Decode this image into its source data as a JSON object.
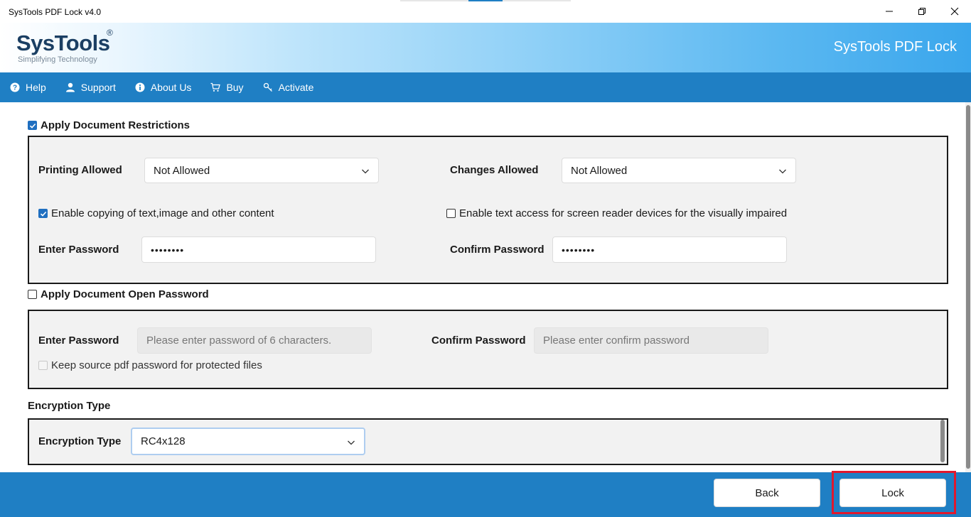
{
  "window": {
    "title": "SysTools PDF Lock v4.0",
    "minimize_icon": "minimize-icon",
    "maximize_icon": "restore-icon",
    "close_icon": "close-icon"
  },
  "header": {
    "logo_text": "SysTools",
    "logo_registered": "®",
    "logo_tagline": "Simplifying Technology",
    "app_name": "SysTools PDF Lock"
  },
  "menu": {
    "items": [
      {
        "label": "Help",
        "icon": "question-circle-icon"
      },
      {
        "label": "Support",
        "icon": "user-icon"
      },
      {
        "label": "About Us",
        "icon": "info-circle-icon"
      },
      {
        "label": "Buy",
        "icon": "cart-icon"
      },
      {
        "label": "Activate",
        "icon": "key-icon"
      }
    ]
  },
  "restrictions": {
    "checkbox_label": "Apply Document Restrictions",
    "checked": true,
    "printing_label": "Printing Allowed",
    "printing_value": "Not Allowed",
    "changes_label": "Changes Allowed",
    "changes_value": "Not Allowed",
    "copy_label": "Enable copying of text,image and other content",
    "copy_checked": true,
    "screen_reader_label": "Enable text access for screen reader devices for the visually impaired",
    "screen_reader_checked": false,
    "password_label": "Enter Password",
    "password_value": "••••••••",
    "confirm_label": "Confirm Password",
    "confirm_value": "••••••••"
  },
  "open_password": {
    "checkbox_label": "Apply Document Open Password",
    "checked": false,
    "password_label": "Enter Password",
    "password_placeholder": "Please enter password of 6 characters.",
    "confirm_label": "Confirm Password",
    "confirm_placeholder": "Please enter confirm password",
    "keep_source_label": "Keep source pdf password for protected files",
    "keep_source_checked": false
  },
  "encryption": {
    "section_title": "Encryption Type",
    "label": "Encryption Type",
    "value": "RC4x128"
  },
  "footer": {
    "back_label": "Back",
    "lock_label": "Lock"
  },
  "colors": {
    "accent": "#1f7fc4",
    "highlight": "#e0182d"
  }
}
